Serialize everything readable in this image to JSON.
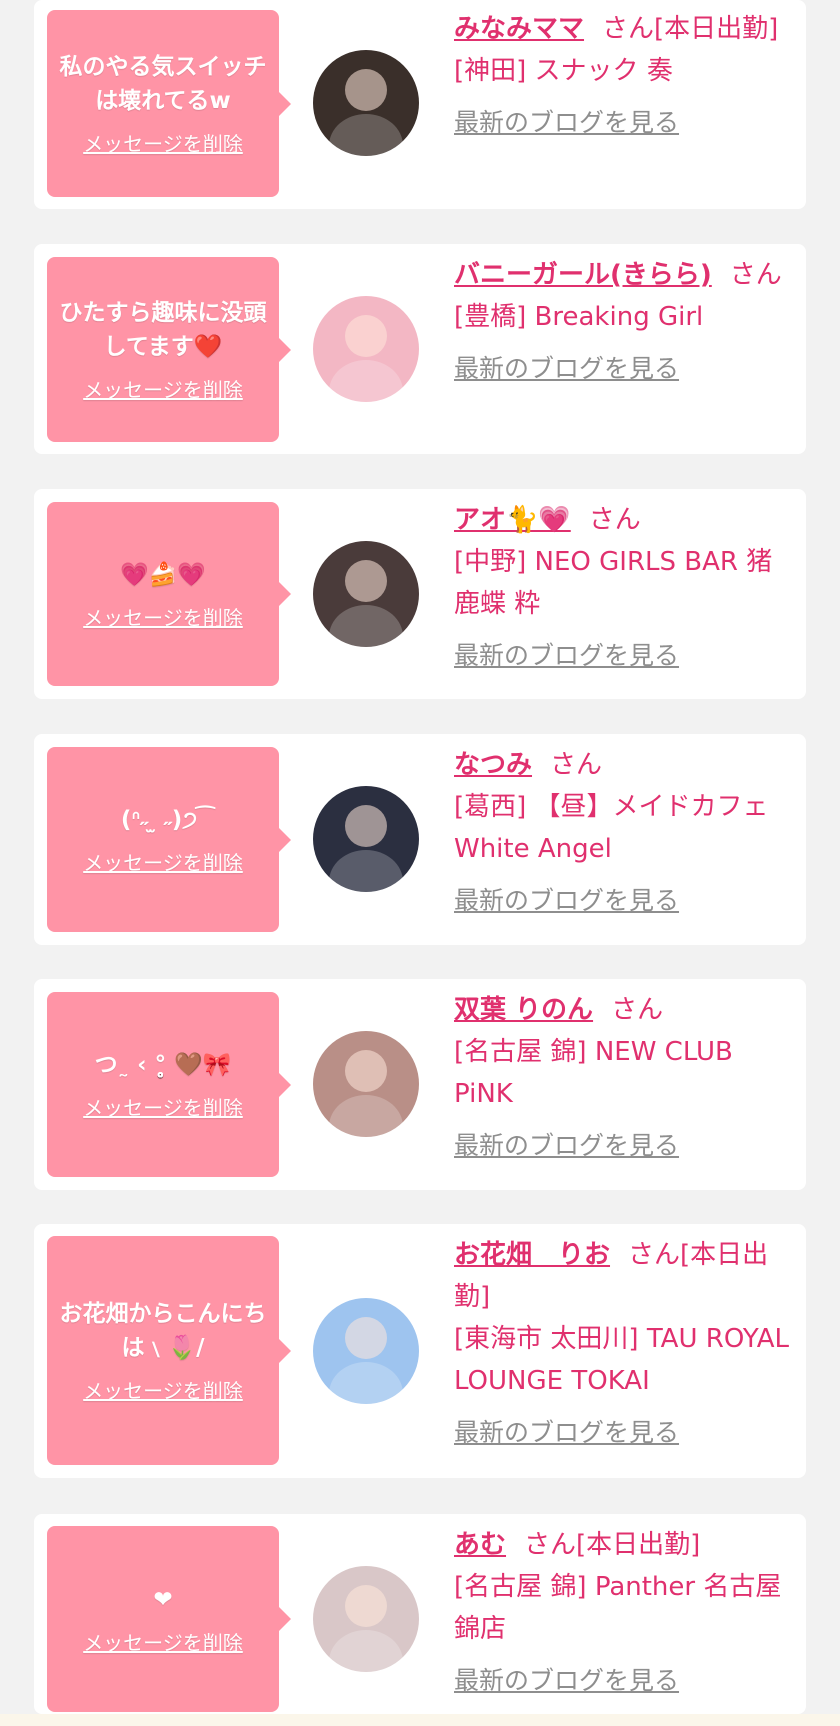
{
  "colors": {
    "background": "#f2f2f2",
    "card": "#ffffff",
    "bubble": "#ff94a6",
    "accent": "#e0306e",
    "link_gray": "#8e8e8e"
  },
  "delete_label": "メッセージを削除",
  "blog_label": "最新のブログを見る",
  "honorific": "さん",
  "entries": [
    {
      "message": "私のやる気スイッチは壊れてるw",
      "name": "みなみママ",
      "status": "[本日出勤]",
      "shop": "[神田] スナック 奏",
      "avatar_color": "#3a2f2a"
    },
    {
      "message": "ひたすら趣味に没頭してます❤️",
      "name": "バニーガール(きらら)",
      "status": "",
      "shop": "[豊橋] Breaking Girl",
      "avatar_color": "#f3b7c4"
    },
    {
      "message": "💗🍰💗",
      "name": "アオ🐈💗",
      "status": "",
      "shop": "[中野] NEO GIRLS BAR 猪鹿蝶 粋",
      "avatar_color": "#4a3b3a"
    },
    {
      "message": "(ᐢ˶ ̫ ˶)੭ ͡",
      "name": "なつみ",
      "status": "",
      "shop": "[葛西] 【昼】メイドカフェ White Angel",
      "avatar_color": "#2b2f40"
    },
    {
      "message": "つ˷ ‹ °̥̥̥̥̥̥̥̥ 🤎🎀",
      "name": "双葉 りのん",
      "status": "",
      "shop": "[名古屋 錦] NEW CLUB PiNK",
      "avatar_color": "#b98f87"
    },
    {
      "message": "お花畑からこんにちは﹨🌷/",
      "name": "お花畑　りお",
      "status": "[本日出勤]",
      "shop": "[東海市 太田川] TAU ROYAL LOUNGE TOKAI",
      "avatar_color": "#9ec4ef"
    },
    {
      "message": "❤",
      "name": "あむ",
      "status": "[本日出勤]",
      "shop": "[名古屋 錦] Panther 名古屋錦店",
      "avatar_color": "#d9c7c8"
    }
  ]
}
